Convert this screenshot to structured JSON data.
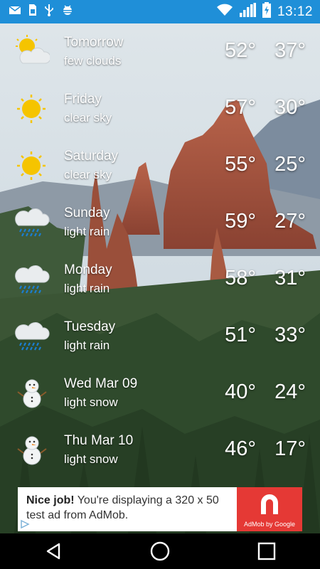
{
  "status_bar": {
    "time": "13:12",
    "left_icons": [
      "email-icon",
      "sim-card-icon",
      "usb-icon",
      "android-debug-icon"
    ],
    "right_icons": [
      "wifi-icon",
      "signal-icon",
      "battery-icon"
    ]
  },
  "forecast": [
    {
      "day": "Tomorrow",
      "desc": "few clouds",
      "hi": "52°",
      "lo": "37°",
      "icon": "partly-cloudy-icon"
    },
    {
      "day": "Friday",
      "desc": "clear sky",
      "hi": "57°",
      "lo": "30°",
      "icon": "sun-icon"
    },
    {
      "day": "Saturday",
      "desc": "clear sky",
      "hi": "55°",
      "lo": "25°",
      "icon": "sun-icon"
    },
    {
      "day": "Sunday",
      "desc": "light rain",
      "hi": "59°",
      "lo": "27°",
      "icon": "rain-cloud-icon"
    },
    {
      "day": "Monday",
      "desc": "light rain",
      "hi": "58°",
      "lo": "31°",
      "icon": "rain-cloud-icon"
    },
    {
      "day": "Tuesday",
      "desc": "light rain",
      "hi": "51°",
      "lo": "33°",
      "icon": "rain-cloud-icon"
    },
    {
      "day": "Wed Mar 09",
      "desc": "light snow",
      "hi": "40°",
      "lo": "24°",
      "icon": "snowman-icon"
    },
    {
      "day": "Thu Mar 10",
      "desc": "light snow",
      "hi": "46°",
      "lo": "17°",
      "icon": "snowman-icon"
    }
  ],
  "ad": {
    "headline": "Nice job!",
    "body": "You're displaying a 320 x 50 test ad from AdMob.",
    "logo_caption": "AdMob by Google"
  },
  "colors": {
    "status_bar": "#1f8fd8",
    "ad_logo": "#e53935",
    "sun": "#f5c400"
  }
}
